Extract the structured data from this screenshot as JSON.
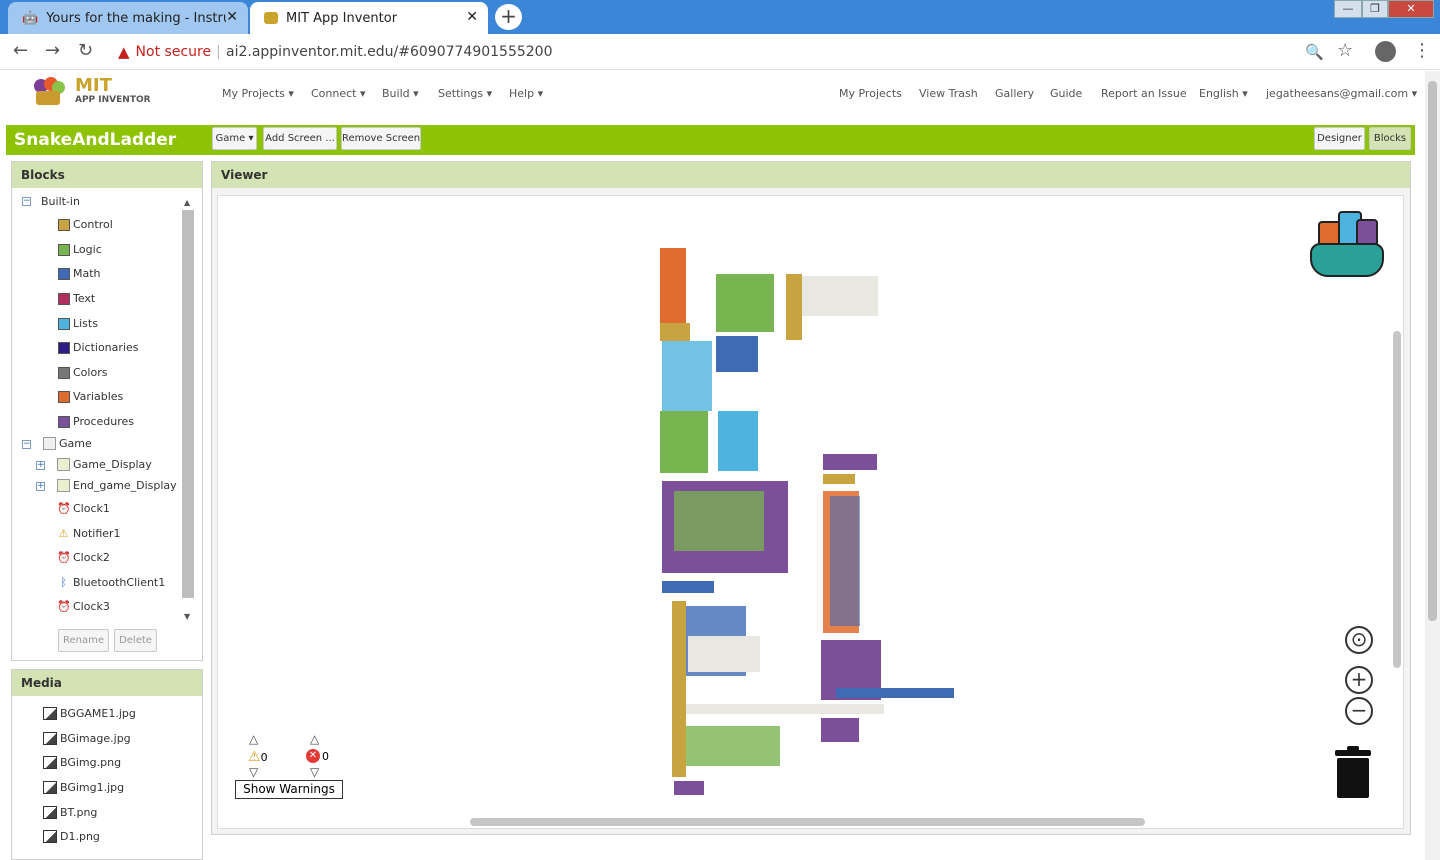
{
  "browser": {
    "tabs": [
      {
        "title": "Yours for the making - Instructab",
        "active": false
      },
      {
        "title": "MIT App Inventor",
        "active": true
      }
    ],
    "security_label": "Not secure",
    "url": "ai2.appinventor.mit.edu/#6090774901555200"
  },
  "header": {
    "logo_main": "MIT",
    "logo_sub": "APP INVENTOR",
    "menus": [
      "My Projects",
      "Connect",
      "Build",
      "Settings",
      "Help"
    ],
    "links": [
      "My Projects",
      "View Trash",
      "Gallery",
      "Guide",
      "Report an Issue"
    ],
    "language": "English",
    "account": "jegatheesans@gmail.com"
  },
  "toolbar": {
    "project_name": "SnakeAndLadder",
    "screen_select": "Game",
    "add_screen": "Add Screen ...",
    "remove_screen": "Remove Screen",
    "designer": "Designer",
    "blocks": "Blocks"
  },
  "blocks_panel": {
    "title": "Blocks",
    "builtin_label": "Built-in",
    "builtin": [
      {
        "label": "Control",
        "color": "#c8a441"
      },
      {
        "label": "Logic",
        "color": "#78b450"
      },
      {
        "label": "Math",
        "color": "#3f6bb5"
      },
      {
        "label": "Text",
        "color": "#b32d5e"
      },
      {
        "label": "Lists",
        "color": "#4fb3e0"
      },
      {
        "label": "Dictionaries",
        "color": "#2b1d85"
      },
      {
        "label": "Colors",
        "color": "#777777"
      },
      {
        "label": "Variables",
        "color": "#e06b2e"
      },
      {
        "label": "Procedures",
        "color": "#7c4f9a"
      }
    ],
    "screen_label": "Game",
    "components": [
      "Game_Display",
      "End_game_Display",
      "Clock1",
      "Notifier1",
      "Clock2",
      "BluetoothClient1",
      "Clock3"
    ],
    "rename": "Rename",
    "delete": "Delete"
  },
  "media_panel": {
    "title": "Media",
    "files": [
      "BGGAME1.jpg",
      "BGimage.jpg",
      "BGimg.png",
      "BGimg1.jpg",
      "BT.png",
      "D1.png"
    ]
  },
  "viewer": {
    "title": "Viewer",
    "warning_count": "0",
    "error_count": "0",
    "show_warnings": "Show Warnings"
  }
}
